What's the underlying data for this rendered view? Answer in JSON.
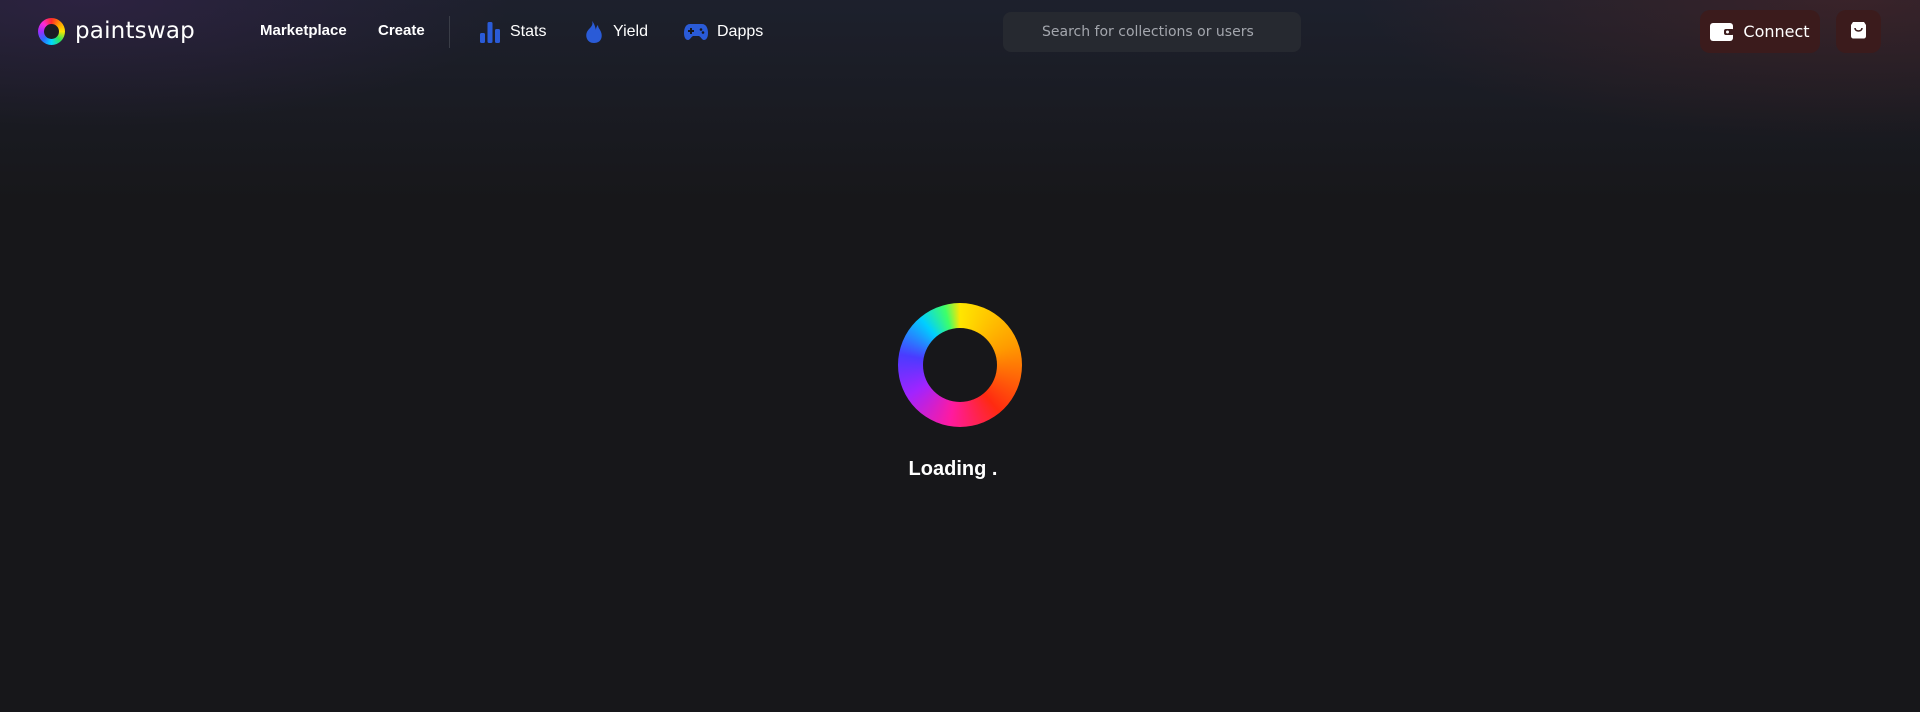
{
  "brand": {
    "name": "paintswap",
    "logo_icon": "color-wheel-logo-icon"
  },
  "nav": {
    "marketplace": "Marketplace",
    "create": "Create",
    "stats": {
      "label": "Stats",
      "icon": "bar-chart-icon"
    },
    "yield": {
      "label": "Yield",
      "icon": "flame-icon"
    },
    "dapps": {
      "label": "Dapps",
      "icon": "gamepad-icon"
    }
  },
  "search": {
    "placeholder": "Search for collections or users",
    "value": ""
  },
  "actions": {
    "connect_label": "Connect",
    "connect_icon": "wallet-icon",
    "cart_icon": "shopping-bag-icon"
  },
  "status": {
    "loading_text": "Loading ."
  },
  "colors": {
    "background": "#17171a",
    "nav_icon_blue": "#2a5bd7",
    "button_bg": "#3b1b1c",
    "search_bg": "#262930"
  }
}
